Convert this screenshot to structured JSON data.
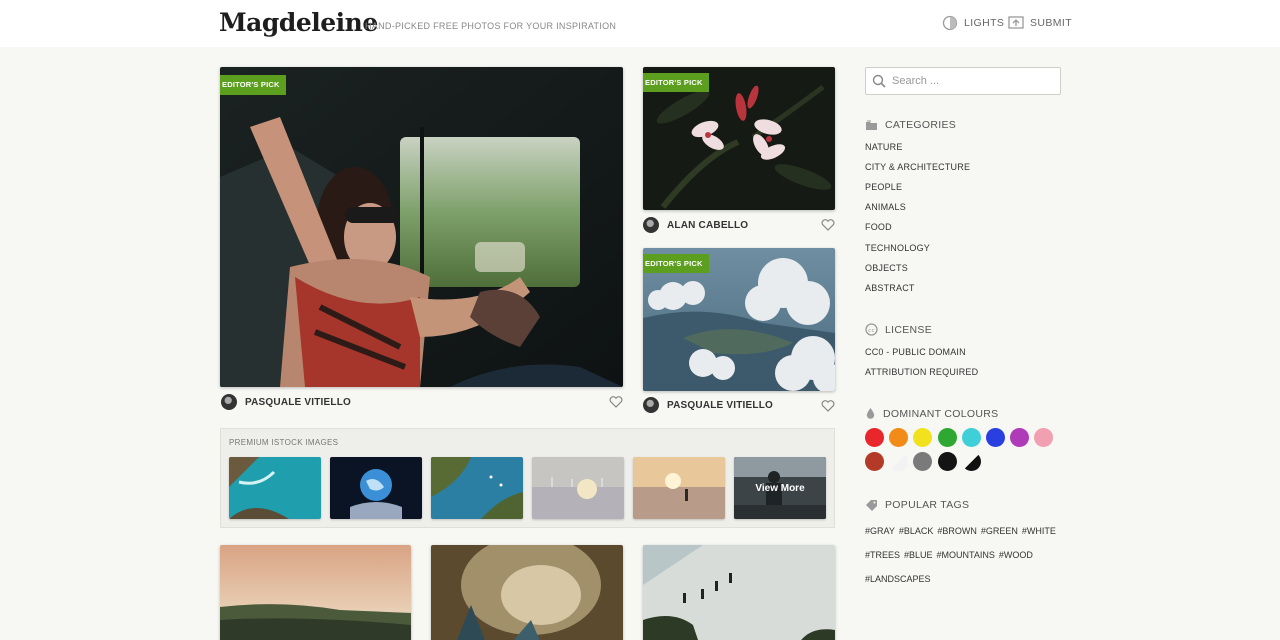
{
  "header": {
    "logo": "Magdeleine",
    "tagline": "HAND-PICKED FREE PHOTOS FOR YOUR INSPIRATION",
    "lights_label": "LIGHTS",
    "submit_label": "SUBMIT"
  },
  "photos": {
    "main": {
      "badge": "EDITOR'S PICK",
      "author": "PASQUALE VITIELLO"
    },
    "flower": {
      "badge": "EDITOR'S PICK",
      "author": "ALAN CABELLO"
    },
    "coast": {
      "badge": "EDITOR'S PICK",
      "author": "PASQUALE VITIELLO"
    }
  },
  "istock": {
    "label": "PREMIUM ISTOCK IMAGES",
    "more_label": "View More"
  },
  "sidebar": {
    "search_placeholder": "Search ...",
    "categories_title": "CATEGORIES",
    "categories": [
      "NATURE",
      "CITY & ARCHITECTURE",
      "PEOPLE",
      "ANIMALS",
      "FOOD",
      "TECHNOLOGY",
      "OBJECTS",
      "ABSTRACT"
    ],
    "license_title": "LICENSE",
    "licenses": [
      "CC0 - PUBLIC DOMAIN",
      "ATTRIBUTION REQUIRED"
    ],
    "colours_title": "DOMINANT COLOURS",
    "colours": [
      "#e8262c",
      "#f28b17",
      "#f2e21d",
      "#2ea832",
      "#3ecfd8",
      "#2a3fe0",
      "#b03bb8",
      "#f0a0b0",
      "#b23a26",
      "#f2f2f2",
      "#7a7a7a",
      "#141414",
      "#111111"
    ],
    "tags_title": "POPULAR TAGS",
    "tag_lines": [
      [
        "#GRAY",
        "#BLACK",
        "#BROWN",
        "#GREEN",
        "#WHITE"
      ],
      [
        "#TREES",
        "#BLUE",
        "#MOUNTAINS",
        "#WOOD"
      ],
      [
        "#LANDSCAPES"
      ]
    ]
  }
}
